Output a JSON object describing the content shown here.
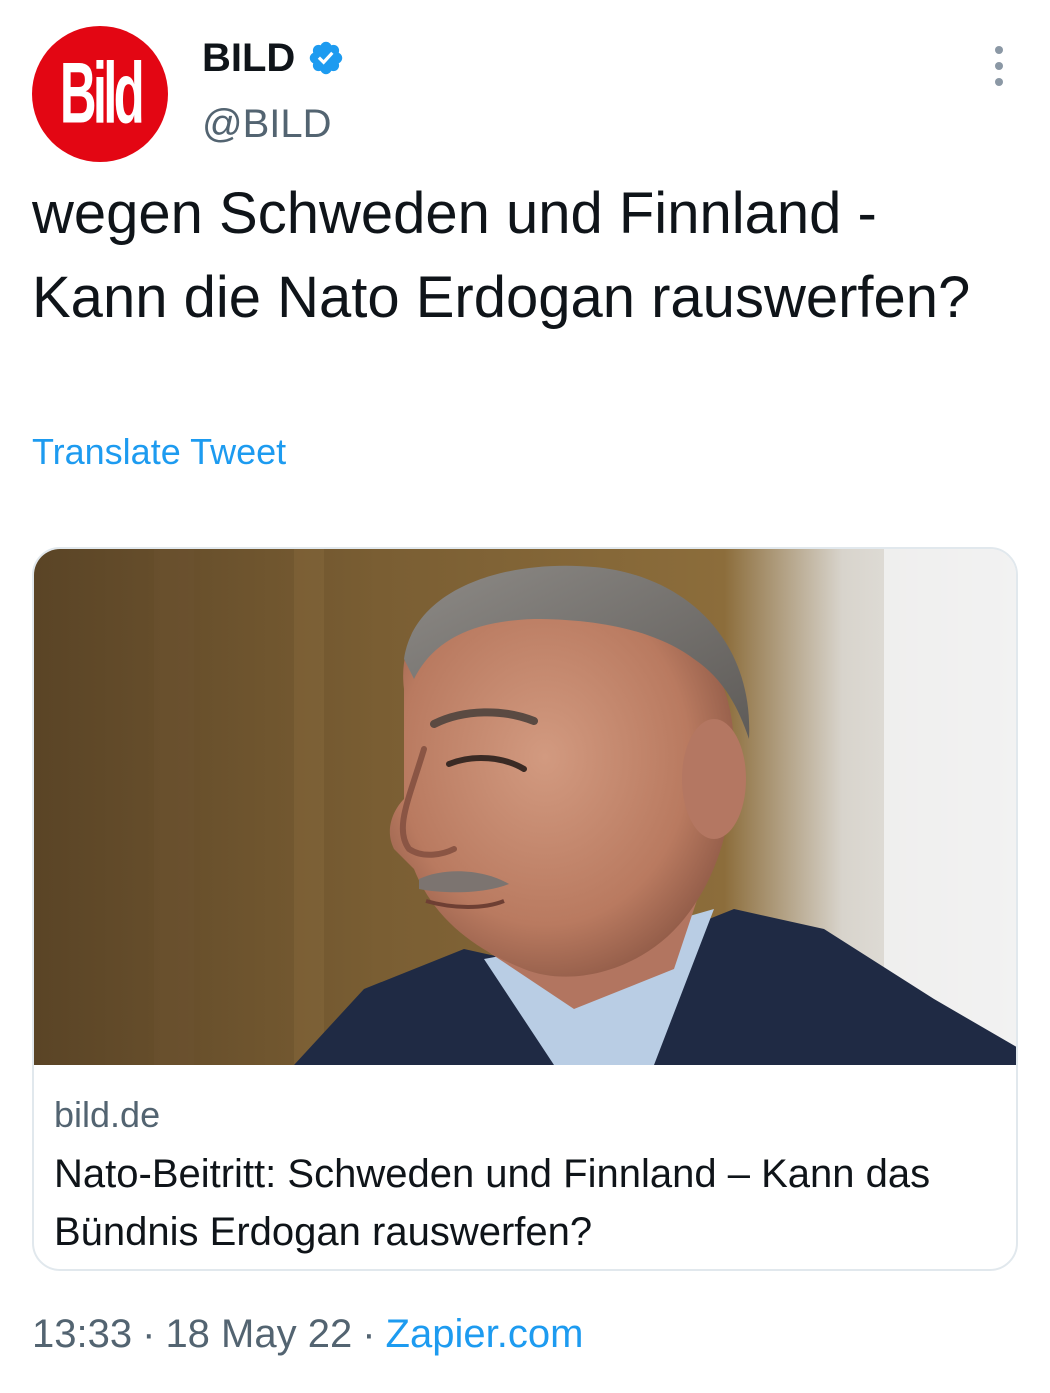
{
  "author": {
    "display_name": "BILD",
    "handle": "@BILD",
    "avatar_text": "Bild",
    "verified_icon": "verified-badge-icon",
    "brand_color": "#e30613"
  },
  "tweet": {
    "text": "wegen Schweden und Finnland - Kann die Nato Erdogan rauswerfen?",
    "translate_label": "Translate Tweet"
  },
  "card": {
    "domain": "bild.de",
    "title": "Nato-Beitritt: Schweden und Finnland – Kann das Bündnis Erdogan rauswerfen?"
  },
  "meta": {
    "time": "13:33",
    "date": "18 May 22",
    "source": "Zapier.com",
    "separator": "·"
  },
  "colors": {
    "link": "#1d9bf0",
    "secondary_text": "#536471"
  }
}
